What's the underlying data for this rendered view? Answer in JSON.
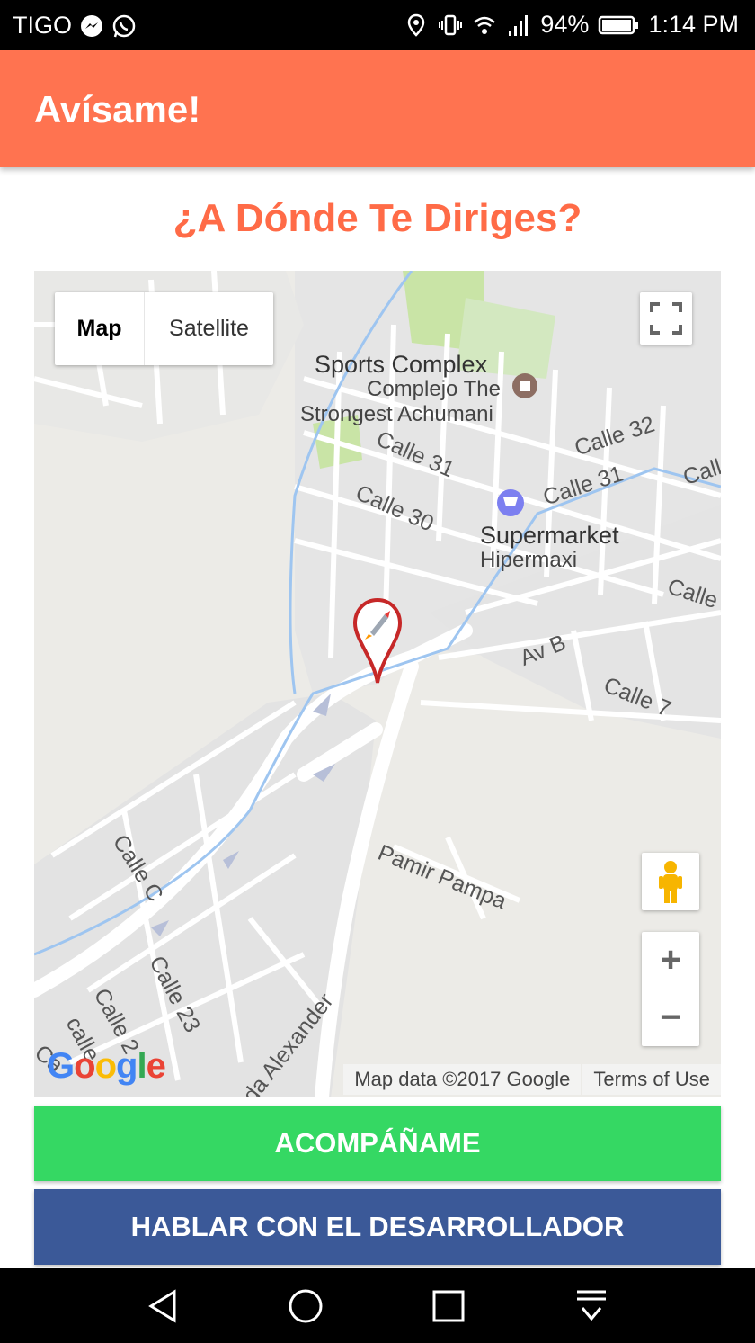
{
  "status_bar": {
    "carrier": "TIGO",
    "battery": "94%",
    "time": "1:14 PM",
    "icons": [
      "messenger-icon",
      "whatsapp-icon",
      "location-icon",
      "vibrate-icon",
      "wifi-icon",
      "signal-icon",
      "battery-icon"
    ]
  },
  "app_bar": {
    "title": "Avísame!",
    "color": "#ff7350"
  },
  "heading": "¿A Dónde Te Diriges?",
  "map": {
    "type_control": {
      "map_label": "Map",
      "satellite_label": "Satellite",
      "selected": "Map"
    },
    "pois": [
      {
        "name": "Sports Complex",
        "subtitle_line1": "Complejo The",
        "subtitle_line2": "Strongest Achumani"
      },
      {
        "name": "Supermarket",
        "subtitle_line1": "Hipermaxi"
      }
    ],
    "streets": [
      "Calle 31",
      "Calle 30",
      "Calle 32",
      "Calle 31",
      "Call",
      "Calle",
      "Av B",
      "Calle 7",
      "Calle C",
      "Pamir Pampa",
      "Calle 23",
      "Calle 2",
      "calle",
      "Ca",
      "da Alexander"
    ],
    "logo": {
      "letters": [
        "G",
        "o",
        "o",
        "g",
        "l",
        "e"
      ],
      "colors": [
        "#4285f4",
        "#ea4335",
        "#fbbc05",
        "#4285f4",
        "#34a853",
        "#ea4335"
      ]
    },
    "attribution": "Map data ©2017 Google",
    "terms": "Terms of Use",
    "zoom_in": "+",
    "zoom_out": "−",
    "marker_icon": "rocket-icon"
  },
  "buttons": {
    "accompany": "ACOMPÁÑAME",
    "talk_developer": "HABLAR CON EL DESARROLLADOR",
    "accompany_color": "#35d863",
    "talk_color": "#3b5998"
  },
  "nav_bar": {
    "icons": [
      "back-icon",
      "home-icon",
      "recents-icon",
      "notifications-icon"
    ]
  }
}
